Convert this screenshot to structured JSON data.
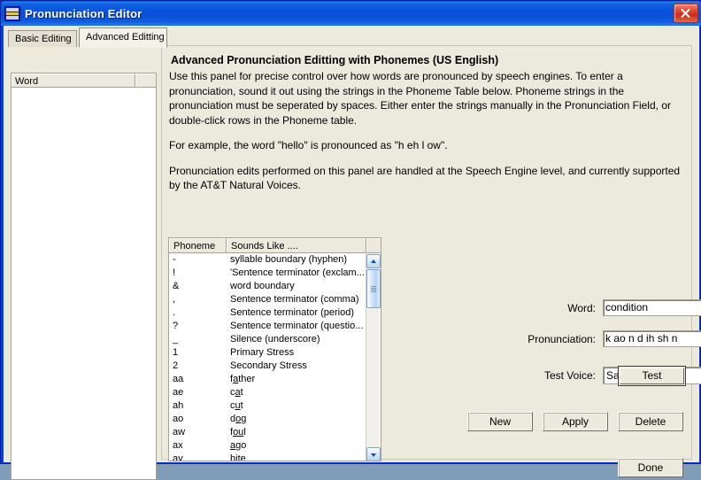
{
  "window": {
    "title": "Pronunciation Editor",
    "icon": "app-icon",
    "close_label": "Close"
  },
  "tabs": [
    {
      "label": "Basic Editing",
      "active": false
    },
    {
      "label": "Advanced Editting",
      "active": true
    }
  ],
  "word_list": {
    "columns": [
      "Word"
    ],
    "rows": []
  },
  "description": {
    "heading": "Advanced Pronunciation Editting with Phonemes (US English)",
    "paragraphs": [
      "Use this panel for precise control over how words are pronounced by speech engines.  To enter a pronunciation, sound it out using the strings in the Phoneme Table below.  Phoneme strings in the pronunciation must be seperated by spaces.  Either enter the strings manually in the Pronunciation Field, or double-click rows in the Phoneme table.",
      "For example, the word \"hello\" is pronounced as \"h eh l ow\".",
      "Pronunciation edits performed on this panel are handled at the Speech Engine level, and currently supported by the AT&T Natural Voices."
    ]
  },
  "phoneme_table": {
    "columns": [
      "Phoneme",
      "Sounds Like ...."
    ],
    "rows": [
      {
        "phoneme": "-",
        "sounds_like": "syllable boundary (hyphen)",
        "underline": ""
      },
      {
        "phoneme": "!",
        "sounds_like": "'Sentence terminator (exclam...",
        "underline": ""
      },
      {
        "phoneme": "&",
        "sounds_like": "word boundary",
        "underline": ""
      },
      {
        "phoneme": ",",
        "sounds_like": "Sentence terminator (comma)",
        "underline": ""
      },
      {
        "phoneme": ".",
        "sounds_like": "Sentence terminator (period)",
        "underline": ""
      },
      {
        "phoneme": "?",
        "sounds_like": "Sentence terminator (questio...",
        "underline": ""
      },
      {
        "phoneme": "_",
        "sounds_like": "Silence (underscore)",
        "underline": ""
      },
      {
        "phoneme": "1",
        "sounds_like": "Primary Stress",
        "underline": ""
      },
      {
        "phoneme": "2",
        "sounds_like": "Secondary Stress",
        "underline": ""
      },
      {
        "phoneme": "aa",
        "sounds_like": "father",
        "underline": "a",
        "pre": "f",
        "post": "ther"
      },
      {
        "phoneme": "ae",
        "sounds_like": "cat",
        "underline": "a",
        "pre": "c",
        "post": "t"
      },
      {
        "phoneme": "ah",
        "sounds_like": "cut",
        "underline": "u",
        "pre": "c",
        "post": "t"
      },
      {
        "phoneme": "ao",
        "sounds_like": "dog",
        "underline": "o",
        "pre": "d",
        "post": "g"
      },
      {
        "phoneme": "aw",
        "sounds_like": "foul",
        "underline": "ou",
        "pre": "f",
        "post": "l"
      },
      {
        "phoneme": "ax",
        "sounds_like": "ago",
        "underline": "a",
        "pre": "",
        "post": "go"
      }
    ],
    "scroll_position": "top"
  },
  "form": {
    "word_label": "Word:",
    "word_value": "condition",
    "pronunciation_label": "Pronunciation:",
    "pronunciation_value": "k ao n d ih sh n",
    "voice_label": "Test Voice:",
    "voice_value": "Sam",
    "voice_options": [
      "Sam"
    ]
  },
  "buttons": {
    "test": "Test",
    "new": "New",
    "apply": "Apply",
    "delete": "Delete",
    "done": "Done"
  },
  "colors": {
    "titlebar_blue": "#0a52dc",
    "panel_beige": "#ece9dd",
    "close_red": "#cf2c18",
    "field_white": "#ffffff"
  }
}
